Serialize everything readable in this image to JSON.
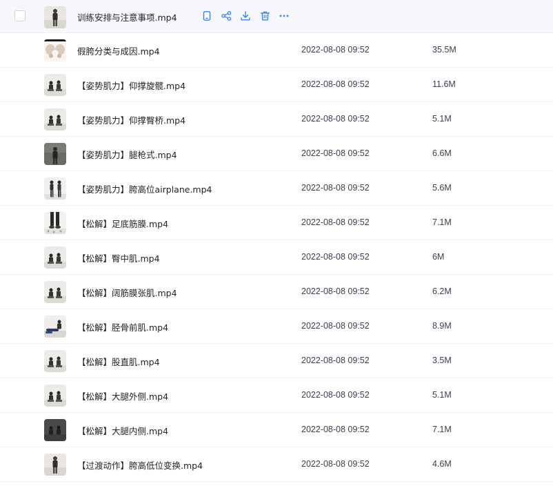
{
  "colors": {
    "accent": "#3b82f6",
    "hover_row": "#f5f7fa",
    "divider": "#eef0f3"
  },
  "actions": [
    {
      "name": "phone-icon"
    },
    {
      "name": "share-icon"
    },
    {
      "name": "download-icon"
    },
    {
      "name": "trash-icon"
    },
    {
      "name": "more-icon"
    }
  ],
  "files": [
    {
      "name": "训练安排与注意事项.mp4",
      "date": "",
      "size": "",
      "thumb": "person-light"
    },
    {
      "name": "假胯分类与成因.mp4",
      "date": "2022-08-08 09:52",
      "size": "35.5M",
      "thumb": "pelvis"
    },
    {
      "name": "【姿势肌力】仰撑旋髋.mp4",
      "date": "2022-08-08 09:52",
      "size": "11.6M",
      "thumb": "two-seated"
    },
    {
      "name": "【姿势肌力】仰撑臀桥.mp4",
      "date": "2022-08-08 09:52",
      "size": "5.1M",
      "thumb": "two-seated"
    },
    {
      "name": "【姿势肌力】腿枪式.mp4",
      "date": "2022-08-08 09:52",
      "size": "6.6M",
      "thumb": "dark-person"
    },
    {
      "name": "【姿势肌力】胯高位airplane.mp4",
      "date": "2022-08-08 09:52",
      "size": "5.6M",
      "thumb": "two-standing"
    },
    {
      "name": "【松解】足底筋膜.mp4",
      "date": "2022-08-08 09:52",
      "size": "7.1M",
      "thumb": "legs"
    },
    {
      "name": "【松解】臀中肌.mp4",
      "date": "2022-08-08 09:52",
      "size": "6M",
      "thumb": "two-seated"
    },
    {
      "name": "【松解】阔筋膜张肌.mp4",
      "date": "2022-08-08 09:52",
      "size": "6.2M",
      "thumb": "two-seated"
    },
    {
      "name": "【松解】胫骨前肌.mp4",
      "date": "2022-08-08 09:52",
      "size": "8.9M",
      "thumb": "lying"
    },
    {
      "name": "【松解】股直肌.mp4",
      "date": "2022-08-08 09:52",
      "size": "3.5M",
      "thumb": "two-seated"
    },
    {
      "name": "【松解】大腿外侧.mp4",
      "date": "2022-08-08 09:52",
      "size": "5.1M",
      "thumb": "two-seated"
    },
    {
      "name": "【松解】大腿内侧.mp4",
      "date": "2022-08-08 09:52",
      "size": "7.1M",
      "thumb": "dark-seated"
    },
    {
      "name": "【过渡动作】胯高低位变换.mp4",
      "date": "2022-08-08 09:52",
      "size": "4.6M",
      "thumb": "person-light"
    }
  ]
}
